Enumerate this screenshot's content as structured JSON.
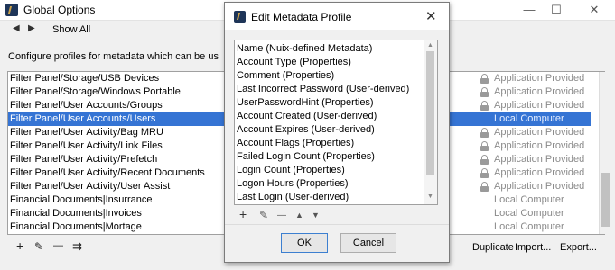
{
  "window": {
    "title": "Global Options",
    "minimize": "—",
    "maximize": "☐",
    "close": "✕"
  },
  "nav": {
    "back": "◀",
    "forward": "▶",
    "show_all": "Show All"
  },
  "configure_text": "Configure profiles for metadata which can be us",
  "profiles": [
    {
      "name": "Filter Panel/Storage/USB Devices",
      "source": "Application Provided",
      "locked": true,
      "selected": false
    },
    {
      "name": "Filter Panel/Storage/Windows Portable",
      "source": "Application Provided",
      "locked": true,
      "selected": false
    },
    {
      "name": "Filter Panel/User Accounts/Groups",
      "source": "Application Provided",
      "locked": true,
      "selected": false
    },
    {
      "name": "Filter Panel/User Accounts/Users",
      "source": "Local Computer",
      "locked": false,
      "selected": true
    },
    {
      "name": "Filter Panel/User Activity/Bag MRU",
      "source": "Application Provided",
      "locked": true,
      "selected": false
    },
    {
      "name": "Filter Panel/User Activity/Link Files",
      "source": "Application Provided",
      "locked": true,
      "selected": false
    },
    {
      "name": "Filter Panel/User Activity/Prefetch",
      "source": "Application Provided",
      "locked": true,
      "selected": false
    },
    {
      "name": "Filter Panel/User Activity/Recent Documents",
      "source": "Application Provided",
      "locked": true,
      "selected": false
    },
    {
      "name": "Filter Panel/User Activity/User Assist",
      "source": "Application Provided",
      "locked": true,
      "selected": false
    },
    {
      "name": "Financial Documents|Insurrance",
      "source": "Local Computer",
      "locked": false,
      "selected": false
    },
    {
      "name": "Financial Documents|Invoices",
      "source": "Local Computer",
      "locked": false,
      "selected": false
    },
    {
      "name": "Financial Documents|Mortage",
      "source": "Local Computer",
      "locked": false,
      "selected": false
    }
  ],
  "toolbar": {
    "add": "+",
    "edit": "✎",
    "remove": "—",
    "import_icon": "⇉"
  },
  "actions": {
    "duplicate": "Duplicate",
    "import": "Import...",
    "export": "Export..."
  },
  "dialog": {
    "title": "Edit Metadata Profile",
    "close": "✕",
    "fields": [
      "Name (Nuix-defined Metadata)",
      "Account Type (Properties)",
      "Comment (Properties)",
      "Last Incorrect Password (User-derived)",
      "UserPasswordHint (Properties)",
      "Account Created (User-derived)",
      "Account Expires (User-derived)",
      "Account Flags (Properties)",
      "Failed Login Count (Properties)",
      "Login Count (Properties)",
      "Logon Hours (Properties)",
      "Last Login (User-derived)"
    ],
    "tools": {
      "add": "+",
      "edit": "✎",
      "remove": "—",
      "up": "▲",
      "down": "▼"
    },
    "ok": "OK",
    "cancel": "Cancel"
  },
  "colors": {
    "selection": "#3574d4",
    "muted_text": "#8a8a8a"
  }
}
